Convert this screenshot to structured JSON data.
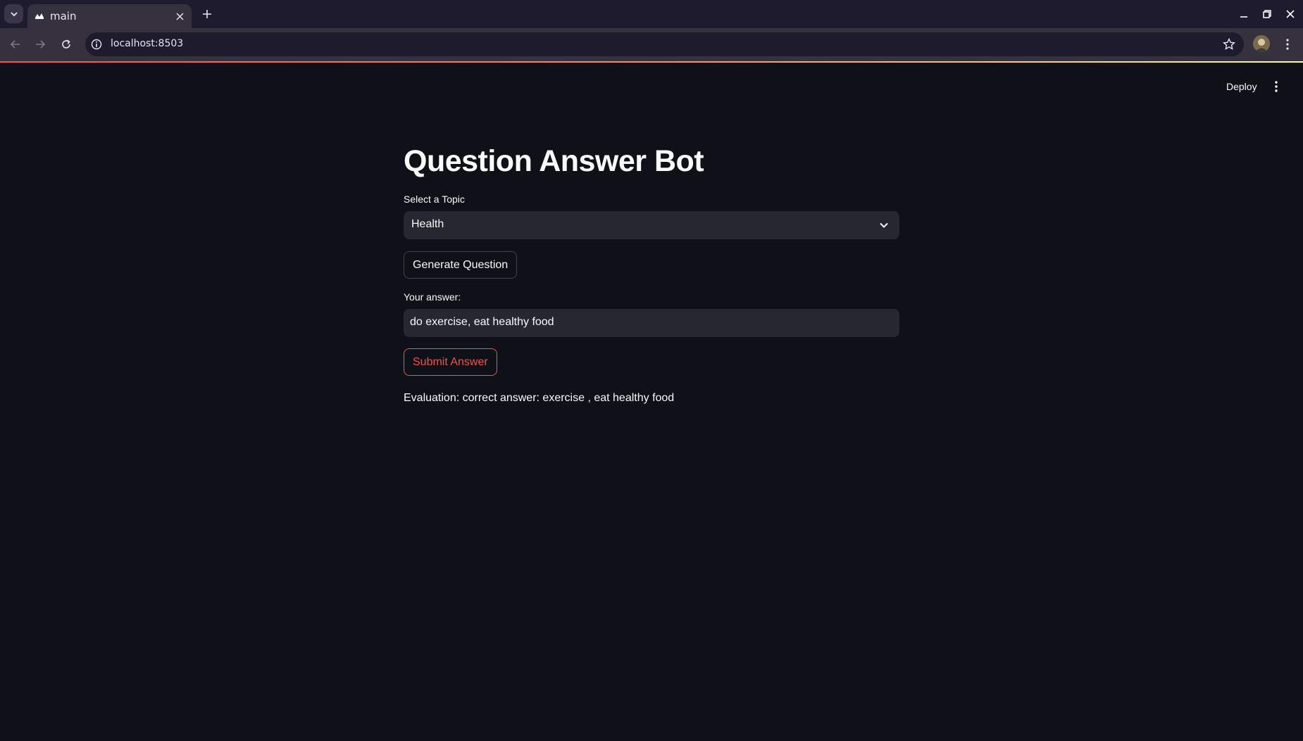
{
  "browser": {
    "tab_title": "main",
    "url": "localhost:8503"
  },
  "app_header": {
    "deploy_label": "Deploy"
  },
  "main": {
    "title": "Question Answer Bot",
    "topic_label": "Select a Topic",
    "topic_selected": "Health",
    "generate_button": "Generate Question",
    "answer_label": "Your answer:",
    "answer_value": "do exercise, eat healthy food",
    "submit_button": "Submit Answer",
    "evaluation": "Evaluation: correct answer: exercise , eat healthy food"
  },
  "colors": {
    "background": "#0e1117",
    "input_background": "#262730",
    "accent": "#ff4b4b",
    "text": "#fafafa"
  },
  "icons": [
    "tab-list-icon",
    "streamlit-favicon",
    "close-icon",
    "plus-icon",
    "minimize-icon",
    "restore-icon",
    "window-close-icon",
    "back-icon",
    "forward-icon",
    "reload-icon",
    "site-info-icon",
    "star-icon",
    "avatar",
    "kebab-menu-icon",
    "chevron-down-icon"
  ]
}
